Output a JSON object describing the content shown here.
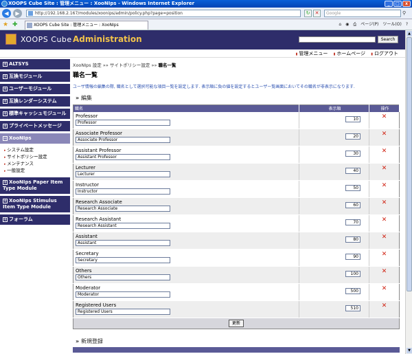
{
  "window": {
    "title": "XOOPS Cube Site : 管理メニュー : XooNIps - Windows Internet Explorer"
  },
  "browser": {
    "address": "http://192.168.2.167/modules/xoonips/admin/policy.php?page=position",
    "search_placeholder": "Google",
    "tab_label": "XOOPS Cube Site : 管理メニュー : XooNIps",
    "page_menu": "ページ(P)",
    "tools_menu": "ツール(O)"
  },
  "header": {
    "logo_text": "XOOPS Cube",
    "admin_label": "Administration",
    "search_button": "Search"
  },
  "toplinks": [
    "管理メニュー",
    "ホームページ",
    "ログアウト"
  ],
  "sidebar": {
    "items": [
      {
        "label": "ALTSYS",
        "mark": "+"
      },
      {
        "label": "互換モジュール",
        "mark": "+"
      },
      {
        "label": "ユーザーモジュール",
        "mark": "+"
      },
      {
        "label": "互換レンダーシステム",
        "mark": "+"
      },
      {
        "label": "標準キャッシュモジュール",
        "mark": "+"
      },
      {
        "label": "プライベートメッセージ",
        "mark": "+"
      },
      {
        "label": "XooNIps",
        "mark": "−"
      },
      {
        "label": "XooNIps Paper Item Type Module",
        "mark": "+"
      },
      {
        "label": "XooNIps Stimulus Item Type Module",
        "mark": "+"
      },
      {
        "label": "フォーラム",
        "mark": "+"
      }
    ],
    "xoonips_sub": [
      "システム設定",
      "サイトポリシー設定",
      "メンテナンス",
      "一般設定"
    ]
  },
  "main": {
    "breadcrumb_1": "XooNIps 設定",
    "breadcrumb_2": "サイトポリシー設定",
    "breadcrumb_3": "職名一覧",
    "breadcrumb_sep": "»»",
    "title": "職名一覧",
    "description": "ユーザ情報の編集の際, 職名として選択可能な項目一覧を設定します. 表示順に負の値を設定するとユーザー覧画面においてその職名が非表示になります.",
    "edit_section": "編集",
    "new_section": "新規登録",
    "columns": {
      "name": "職名",
      "order": "表示順",
      "action": "操作"
    },
    "rows": [
      {
        "name": "Professor",
        "order": "10"
      },
      {
        "name": "Associate Professor",
        "order": "20"
      },
      {
        "name": "Assistant Professor",
        "order": "30"
      },
      {
        "name": "Lecturer",
        "order": "40"
      },
      {
        "name": "Instructor",
        "order": "50"
      },
      {
        "name": "Research Associate",
        "order": "60"
      },
      {
        "name": "Research Assistant",
        "order": "70"
      },
      {
        "name": "Assistant",
        "order": "80"
      },
      {
        "name": "Secretary",
        "order": "90"
      },
      {
        "name": "Others",
        "order": "100"
      },
      {
        "name": "Moderator",
        "order": "500"
      },
      {
        "name": "Registered Users",
        "order": "510"
      }
    ],
    "delete_glyph": "✕",
    "update_button": "更新"
  }
}
